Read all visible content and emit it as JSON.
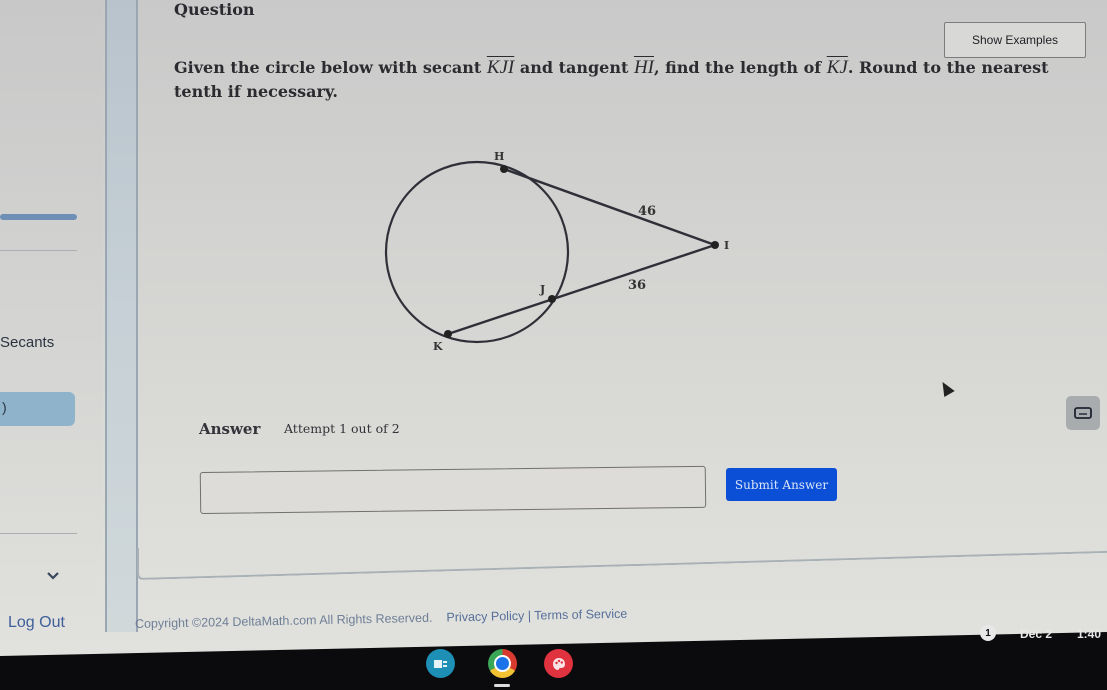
{
  "sidebar": {
    "topic_label": "Secants",
    "active_item_label": ")",
    "logout_label": "Log Out"
  },
  "question": {
    "header": "Question",
    "show_examples_label": "Show Examples",
    "text_parts": {
      "p1": "Given the circle below with secant ",
      "secant": "KJI",
      "p2": " and tangent ",
      "tangent": "HI",
      "p3": ", find the length of ",
      "target": "KJ",
      "p4": ". Round to the nearest tenth if necessary."
    }
  },
  "diagram": {
    "points": {
      "H": "H",
      "I": "I",
      "J": "J",
      "K": "K"
    },
    "tangent_length_label": "46",
    "external_secant_label": "36"
  },
  "answer": {
    "label": "Answer",
    "attempt": "Attempt 1 out of 2",
    "input_value": "",
    "input_placeholder": "",
    "submit_label": "Submit Answer"
  },
  "footer": {
    "copyright": "Copyright ©2024 DeltaMath.com All Rights Reserved.",
    "privacy": "Privacy Policy",
    "separator": " | ",
    "terms": "Terms of Service"
  },
  "taskbar": {
    "apps": [
      "classroom-app",
      "chrome",
      "canvas-paint-app"
    ],
    "notification_count": "1",
    "date": "Dec 2",
    "time": "1:40"
  },
  "colors": {
    "submit_bg": "#0b4fd6",
    "sidebar_active": "#8fb3ca",
    "logout_link": "#3f5f9a"
  }
}
